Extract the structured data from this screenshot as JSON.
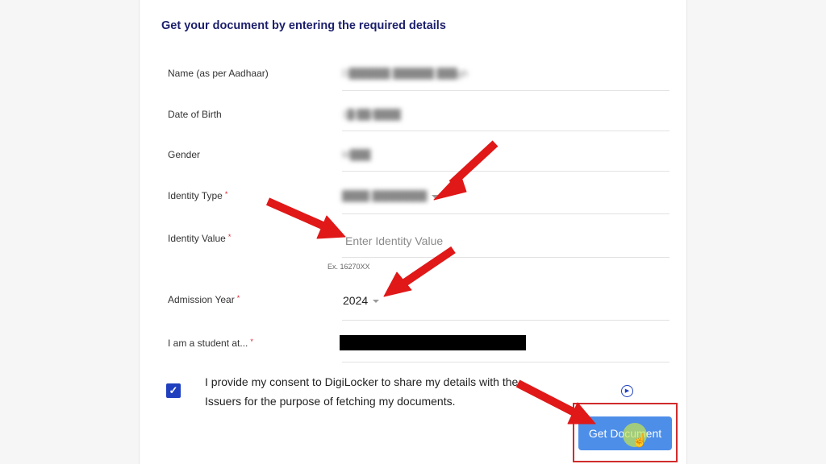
{
  "heading": "Get your document by entering the required details",
  "fields": {
    "name": {
      "label": "Name (as per Aadhaar)",
      "value": "D██████ ██████ ███gh"
    },
    "dob": {
      "label": "Date of Birth",
      "value": "1█/██/████"
    },
    "gender": {
      "label": "Gender",
      "value": "M███"
    },
    "identity_type": {
      "label": "Identity Type",
      "required_mark": "*",
      "value": "████ ████████"
    },
    "identity_value": {
      "label": "Identity Value",
      "required_mark": "*",
      "placeholder": "Enter Identity Value",
      "hint": "Ex. 16270XX"
    },
    "admission_year": {
      "label": "Admission Year",
      "required_mark": "*",
      "value": "2024"
    },
    "student_at": {
      "label": "I am a student at...",
      "required_mark": "*"
    }
  },
  "consent": {
    "checked": true,
    "check_glyph": "✓",
    "text": "I provide my consent to DigiLocker to share my details with the Issuers for the purpose of fetching my documents."
  },
  "play_glyph": "▶",
  "button": {
    "label": "Get Document"
  },
  "cursor_glyph": "☝",
  "colors": {
    "heading": "#1b1f6b",
    "accent": "#1f3fbf",
    "button": "#4d8ee8",
    "annotation_red": "#e01818"
  },
  "icons": [
    "dropdown-caret-icon",
    "play-circle-icon",
    "check-icon",
    "hand-cursor-icon",
    "annotation-arrow"
  ]
}
